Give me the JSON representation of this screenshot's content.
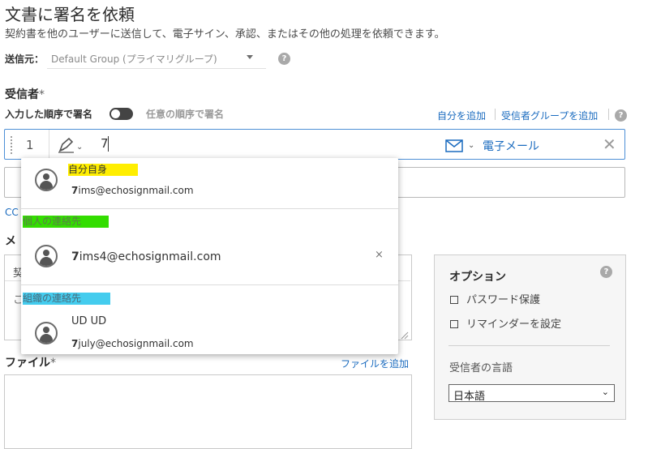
{
  "header": {
    "title": "文書に署名を依頼",
    "subtitle": "契約書を他のユーザーに送信して、電子サイン、承認、またはその他の処理を依頼できます。"
  },
  "sender": {
    "label": "送信元：",
    "value": "Default Group (プライマリグループ)"
  },
  "recipients": {
    "label": "受信者",
    "required_mark": "*",
    "order_label": "入力した順序で署名",
    "any_order_label": "任意の順序で署名",
    "add_self": "自分を追加",
    "add_group": "受信者グループを追加",
    "row": {
      "number": "1",
      "typed": "7",
      "delivery": "電子メール"
    },
    "cc": "CC"
  },
  "message": {
    "label_fragment": "メ",
    "fragment1": "契",
    "fragment2": "こ"
  },
  "files": {
    "label": "ファイル",
    "required_mark": "*",
    "add_file": "ファイルを追加"
  },
  "options": {
    "title": "オプション",
    "password": "パスワード保護",
    "reminder": "リマインダーを設定",
    "language_label": "受信者の言語",
    "language_value": "日本語"
  },
  "help_glyph": "?",
  "dropdown": {
    "groups": [
      {
        "label": "自分自身",
        "highlight": "#ffee00",
        "items": [
          {
            "name": "",
            "email_bold": "7",
            "email_rest": "ims@echosignmail.com"
          }
        ]
      },
      {
        "label": "個人の連絡先",
        "highlight": "#33dd00",
        "items": [
          {
            "name": "",
            "email_bold": "7",
            "email_rest": "ims4@echosignmail.com"
          }
        ]
      },
      {
        "label": "組織の連絡先",
        "highlight": "#44ccee",
        "items": [
          {
            "name": "UD UD",
            "email_bold": "7",
            "email_rest": "july@echosignmail.com"
          }
        ]
      }
    ],
    "remove_glyph": "×"
  },
  "colors": {
    "accent": "#1a6bbf",
    "active_border": "#4d8fd6"
  }
}
